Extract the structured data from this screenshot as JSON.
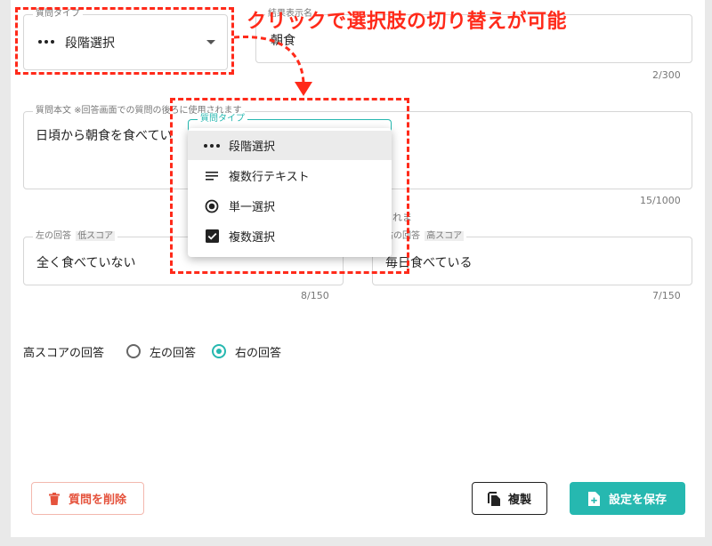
{
  "annotation": "クリックで選択肢の切り替えが可能",
  "question_type": {
    "label": "質問タイプ",
    "value": "段階選択"
  },
  "result_display": {
    "label": "結果表示名",
    "value": "朝食",
    "counter": "2/300"
  },
  "question_body": {
    "label": "質問本文 ※回答画面での質問の後ろに使用されます",
    "value": "日頃から朝食を食べてい",
    "counter": "15/1000"
  },
  "hint_fragment": "れま",
  "left_answer": {
    "label": "左の回答",
    "tag": "低スコア",
    "value": "全く食べていない",
    "counter": "8/150"
  },
  "right_answer": {
    "label": "右の回答",
    "tag": "高スコア",
    "value": "毎日食べている",
    "counter": "7/150"
  },
  "high_score": {
    "label": "高スコアの回答",
    "options": [
      "左の回答",
      "右の回答"
    ],
    "selected": "右の回答"
  },
  "dropdown": {
    "label": "質問タイプ",
    "items": [
      {
        "label": "段階選択",
        "icon": "steps-icon"
      },
      {
        "label": "複数行テキスト",
        "icon": "lines-icon"
      },
      {
        "label": "単一選択",
        "icon": "radio-icon"
      },
      {
        "label": "複数選択",
        "icon": "checkbox-icon"
      }
    ]
  },
  "buttons": {
    "delete": "質問を削除",
    "duplicate": "複製",
    "save": "設定を保存"
  },
  "colors": {
    "accent": "#26b8b0",
    "danger": "#e5533d",
    "annotation": "#ff2a1a"
  }
}
